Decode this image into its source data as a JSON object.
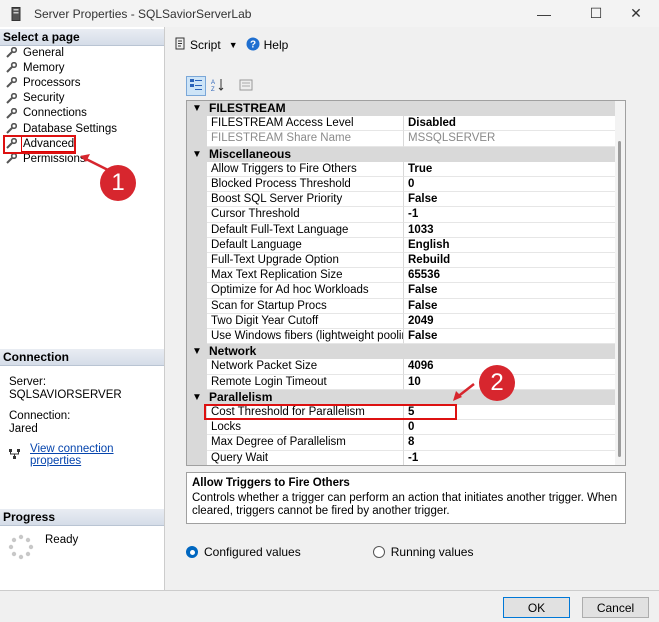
{
  "window": {
    "title": "Server Properties - SQLSaviorServerLab",
    "minimize_glyph": "—",
    "maximize_glyph": "☐",
    "close_glyph": "✕"
  },
  "left_panel": {
    "select_page_header": "Select a page",
    "pages": [
      {
        "label": "General",
        "icon": "wrench-icon"
      },
      {
        "label": "Memory",
        "icon": "wrench-icon"
      },
      {
        "label": "Processors",
        "icon": "wrench-icon"
      },
      {
        "label": "Security",
        "icon": "wrench-icon"
      },
      {
        "label": "Connections",
        "icon": "wrench-icon"
      },
      {
        "label": "Database Settings",
        "icon": "wrench-icon"
      },
      {
        "label": "Advanced",
        "icon": "wrench-icon",
        "selected": true
      },
      {
        "label": "Permissions",
        "icon": "wrench-icon"
      }
    ],
    "connection_header": "Connection",
    "server_label": "Server:",
    "server_value": "SQLSAVIORSERVER",
    "connection_label": "Connection:",
    "connection_value": "Jared",
    "view_connection_link": "View connection properties",
    "progress_header": "Progress",
    "progress_status": "Ready"
  },
  "toolbar": {
    "script_label": "Script",
    "help_label": "Help"
  },
  "grid": {
    "categories": [
      {
        "name": "FILESTREAM",
        "expanded": true
      },
      {
        "name": "Miscellaneous",
        "expanded": true
      },
      {
        "name": "Network",
        "expanded": true
      },
      {
        "name": "Parallelism",
        "expanded": true
      }
    ],
    "rows": [
      {
        "type": "cat",
        "label": "FILESTREAM"
      },
      {
        "type": "prop",
        "name": "FILESTREAM Access Level",
        "value": "Disabled"
      },
      {
        "type": "prop",
        "name": "FILESTREAM Share Name",
        "value": "MSSQLSERVER",
        "disabled": true
      },
      {
        "type": "cat",
        "label": "Miscellaneous"
      },
      {
        "type": "prop",
        "name": "Allow Triggers to Fire Others",
        "value": "True"
      },
      {
        "type": "prop",
        "name": "Blocked Process Threshold",
        "value": "0"
      },
      {
        "type": "prop",
        "name": "Boost SQL Server Priority",
        "value": "False"
      },
      {
        "type": "prop",
        "name": "Cursor Threshold",
        "value": "-1"
      },
      {
        "type": "prop",
        "name": "Default Full-Text Language",
        "value": "1033"
      },
      {
        "type": "prop",
        "name": "Default Language",
        "value": "English"
      },
      {
        "type": "prop",
        "name": "Full-Text Upgrade Option",
        "value": "Rebuild"
      },
      {
        "type": "prop",
        "name": "Max Text Replication Size",
        "value": "65536"
      },
      {
        "type": "prop",
        "name": "Optimize for Ad hoc Workloads",
        "value": "False"
      },
      {
        "type": "prop",
        "name": "Scan for Startup Procs",
        "value": "False"
      },
      {
        "type": "prop",
        "name": "Two Digit Year Cutoff",
        "value": "2049"
      },
      {
        "type": "prop",
        "name": "Use Windows fibers (lightweight pooling)",
        "value": "False"
      },
      {
        "type": "cat",
        "label": "Network"
      },
      {
        "type": "prop",
        "name": "Network Packet Size",
        "value": "4096"
      },
      {
        "type": "prop",
        "name": "Remote Login Timeout",
        "value": "10"
      },
      {
        "type": "cat",
        "label": "Parallelism"
      },
      {
        "type": "prop",
        "name": "Cost Threshold for Parallelism",
        "value": "5",
        "highlight": true
      },
      {
        "type": "prop",
        "name": "Locks",
        "value": "0"
      },
      {
        "type": "prop",
        "name": "Max Degree of Parallelism",
        "value": "8"
      },
      {
        "type": "prop",
        "name": "Query Wait",
        "value": "-1"
      }
    ]
  },
  "description": {
    "title": "Allow Triggers to Fire Others",
    "text": "Controls whether a trigger can perform an action that initiates another trigger. When cleared, triggers cannot be fired by another trigger."
  },
  "radios": {
    "configured_label": "Configured values",
    "running_label": "Running values",
    "selected": "configured"
  },
  "buttons": {
    "ok_label": "OK",
    "cancel_label": "Cancel"
  },
  "annotations": {
    "badge_1": "1",
    "badge_2": "2",
    "color": "#d7262e"
  }
}
